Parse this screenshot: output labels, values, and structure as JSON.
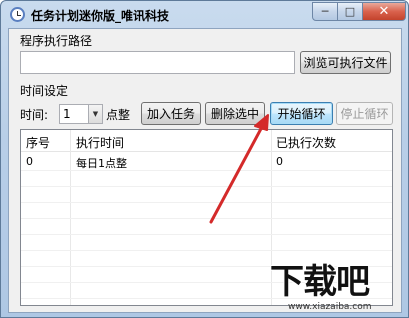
{
  "window": {
    "title": "任务计划迷你版_唯讯科技",
    "minimize_glyph": "─",
    "maximize_glyph": "□",
    "close_glyph": "✕"
  },
  "path_section": {
    "label": "程序执行路径",
    "input_value": "",
    "browse_label": "浏览可执行文件"
  },
  "time_section": {
    "label": "时间设定",
    "time_label": "时间:",
    "hour_value": "1",
    "hour_suffix": "点整",
    "add_label": "加入任务",
    "delete_label": "删除选中",
    "start_label": "开始循环",
    "stop_label": "停止循环"
  },
  "table": {
    "columns": [
      "序号",
      "执行时间",
      "已执行次数"
    ],
    "rows": [
      {
        "index": "0",
        "time": "每日1点整",
        "count": "0"
      }
    ]
  },
  "watermark": {
    "main": "下载吧",
    "sub": "www.xiazaiba.com"
  },
  "colors": {
    "accent_arrow": "#d42a2a",
    "title_bar": "#b9cfe8",
    "close_button": "#d9624d"
  }
}
